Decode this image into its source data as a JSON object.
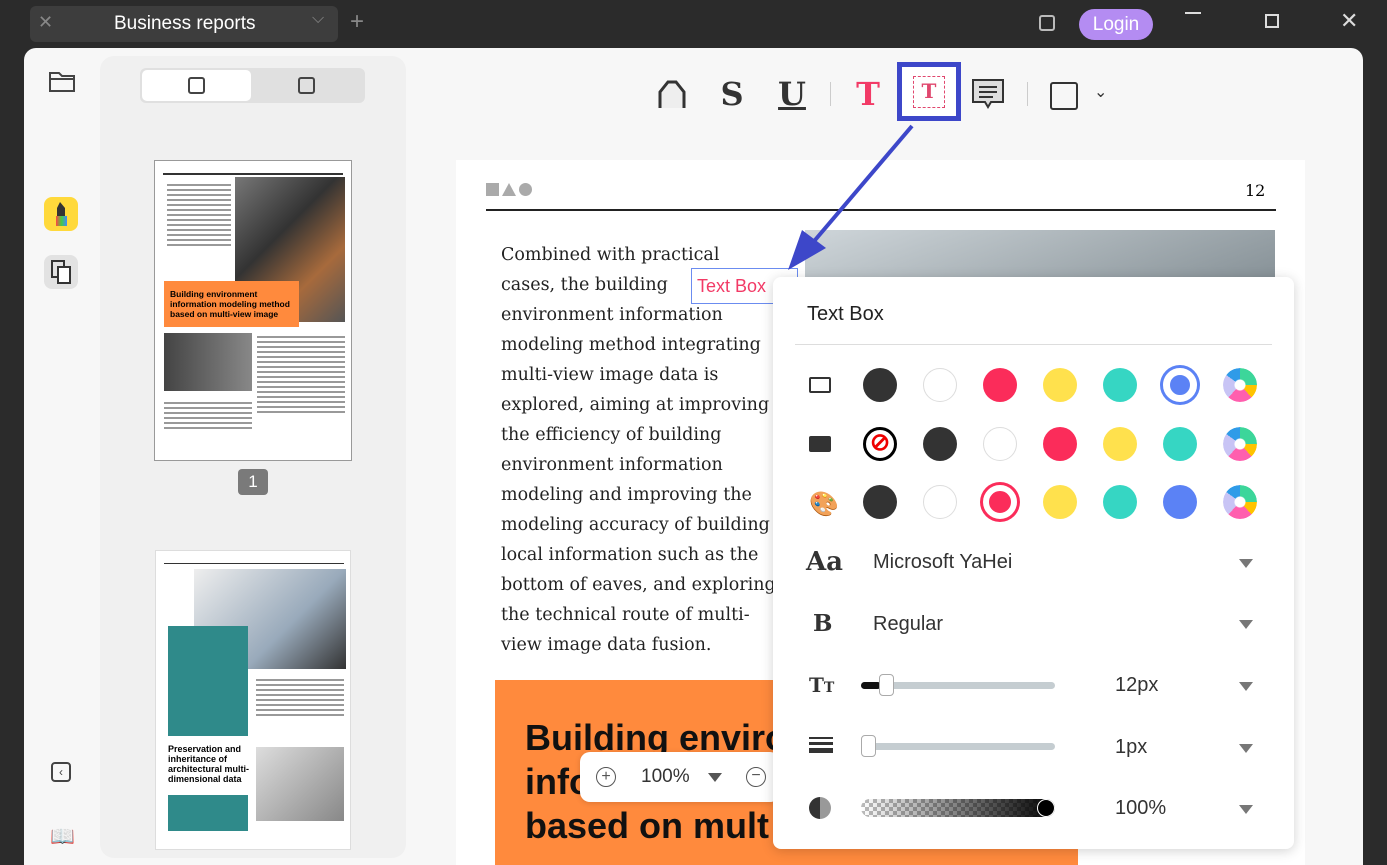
{
  "titlebar": {
    "tab_title": "Business reports",
    "login_label": "Login"
  },
  "thumbnails": {
    "page_badge": "1",
    "thumb1_heading": "Building environment information modeling method based on multi-view image",
    "thumb2_heading": "Preservation and inheritance of architectural multi-dimensional data"
  },
  "toolbar": {
    "tools": [
      "highlight",
      "strikethrough",
      "underline",
      "text",
      "text-box",
      "comment",
      "shape"
    ]
  },
  "document": {
    "page_number": "12",
    "paragraph_lines": [
      "Combined with practical",
      "cases, the building",
      "environment information",
      "modeling method integrating",
      "multi-view image data is",
      "explored, aiming at improving",
      "the efficiency of building",
      "environment information",
      "modeling and improving the",
      "modeling accuracy of building",
      "local information such as the",
      "bottom of eaves, and exploring",
      "the technical route of multi-",
      "view image data fusion."
    ],
    "text_box_annotation": "Text Box",
    "heading": "Building enviro\ninfo\nbased on mult"
  },
  "zoom": {
    "level": "100%"
  },
  "panel": {
    "title": "Text Box",
    "colors": {
      "dark": "#333333",
      "white": "#ffffff",
      "red": "#fb2c5a",
      "yellow": "#ffe14d",
      "teal": "#36d6c3",
      "blue": "#5b82f5"
    },
    "border_row": {
      "selected": "blue"
    },
    "fill_row": {
      "selected": "none"
    },
    "text_row": {
      "selected": "red"
    },
    "font_family": "Microsoft YaHei",
    "font_weight": "Regular",
    "font_size": "12px",
    "font_size_fraction": 0.1,
    "border_width": "1px",
    "border_width_fraction": 0,
    "opacity": "100%",
    "accent": "#3d47c9"
  }
}
